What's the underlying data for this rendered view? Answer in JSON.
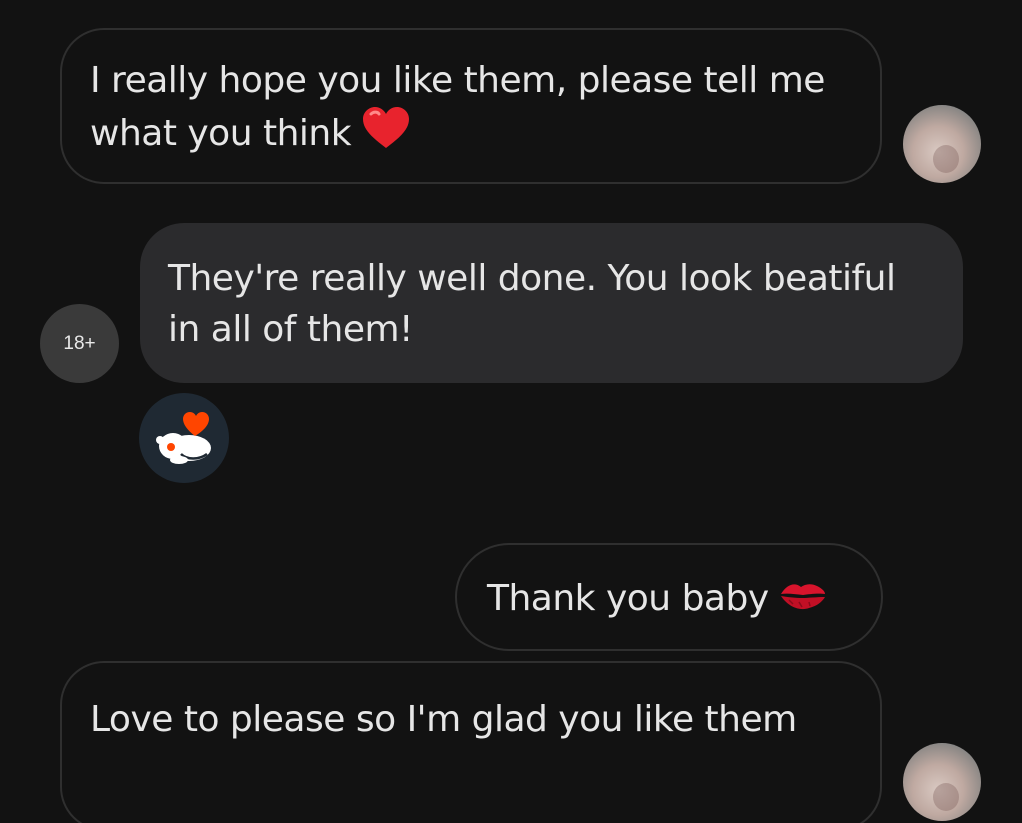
{
  "messages": [
    {
      "id": "msg1",
      "direction": "outgoing",
      "text": "I really hope you like them, please tell me what you think",
      "emoji": "red-heart"
    },
    {
      "id": "msg2",
      "direction": "incoming",
      "text": "They're really well done. You look beatiful in all of them!"
    },
    {
      "id": "msg3",
      "direction": "outgoing",
      "text": "Thank you baby",
      "emoji": "kiss-mark"
    },
    {
      "id": "msg4",
      "direction": "outgoing",
      "text": "Love to please so I'm glad you like them"
    }
  ],
  "contact_avatar": {
    "label": "18+"
  },
  "reaction": {
    "icon": "reddit-snoo-heart-icon"
  },
  "colors": {
    "background": "#121212",
    "incoming_bubble": "#2b2b2d",
    "outgoing_border": "#2f2f2f",
    "text": "#e6e6e6",
    "heart": "#e8232d",
    "reddit_orange": "#ff4500"
  }
}
